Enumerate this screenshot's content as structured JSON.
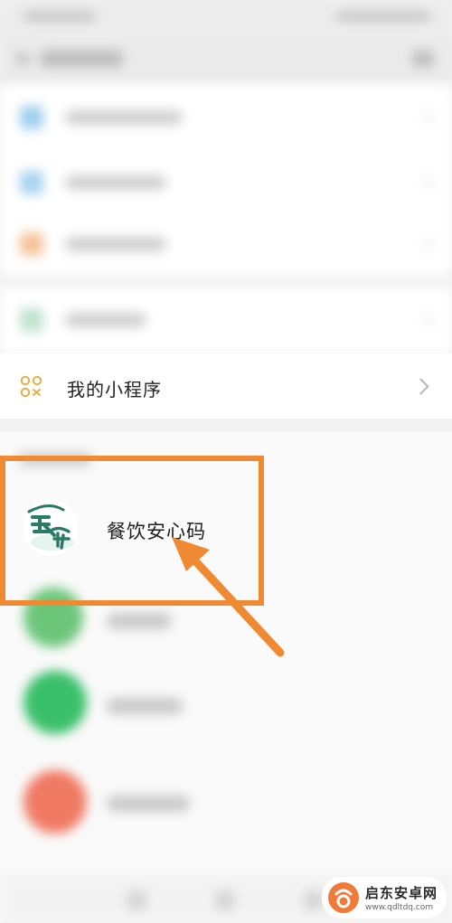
{
  "mini_programs": {
    "label": "我的小程序",
    "selected_app": {
      "name": "餐饮安心码",
      "icon": "shi-an-logo"
    }
  },
  "annotation": {
    "highlight_color": "#f08a32",
    "arrow_color": "#f08a32"
  },
  "watermark": {
    "title": "启东安卓网",
    "url": "www.qdltdq.com"
  },
  "colors": {
    "accent_orange": "#f08a32",
    "app_green": "#2b7a66",
    "miniprog_icon": "#e2b04a"
  }
}
